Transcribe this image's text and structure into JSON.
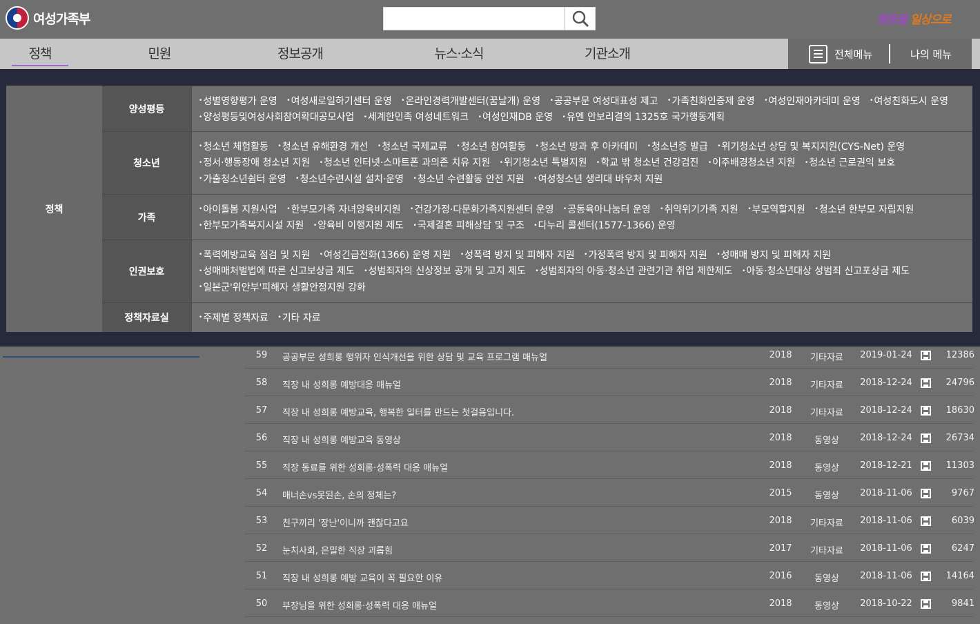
{
  "header": {
    "logo_text": "여성가족부",
    "search_placeholder": "",
    "slogan_a": "평등을",
    "slogan_b": "일상으로"
  },
  "gnb": [
    {
      "label": "정책",
      "active": true
    },
    {
      "label": "민원"
    },
    {
      "label": "정보공개"
    },
    {
      "label": "뉴스·소식"
    },
    {
      "label": "기관소개"
    }
  ],
  "gnb_right": {
    "all_menu": "전체메뉴",
    "my_menu": "나의 메뉴"
  },
  "mega": {
    "category": "정책",
    "sections": [
      {
        "title": "양성평등",
        "items": [
          "성별영향평가 운영",
          "여성새로일하기센터 운영",
          "온라인경력개발센터(꿈날개) 운영",
          "공공부문 여성대표성 제고",
          "가족친화인증제 운영",
          "여성인재아카데미 운영",
          "여성친화도시 운영",
          "양성평등및여성사회참여확대공모사업",
          "세계한민족 여성네트워크",
          "여성인재DB 운영",
          "유엔 안보리결의 1325호 국가행동계획"
        ]
      },
      {
        "title": "청소년",
        "items": [
          "청소년 체험활동",
          "청소년 유해환경 개선",
          "청소년 국제교류",
          "청소년 참여활동",
          "청소년 방과 후 아카데미",
          "청소년증 발급",
          "위기청소년 상담 및 복지지원(CYS-Net) 운영",
          "정서·행동장애 청소년 지원",
          "청소년 인터넷·스마트폰 과의존 치유 지원",
          "위기청소년 특별지원",
          "학교 밖 청소년 건강검진",
          "이주배경청소년 지원",
          "청소년 근로권익 보호",
          "가출청소년쉼터 운영",
          "청소년수련시설 설치·운영",
          "청소년 수련활동 안전 지원",
          "여성청소년 생리대 바우처 지원"
        ]
      },
      {
        "title": "가족",
        "items": [
          "아이돌봄 지원사업",
          "한부모가족 자녀양육비지원",
          "건강가정·다문화가족지원센터 운영",
          "공동육아나눔터 운영",
          "취약위기가족 지원",
          "부모역할지원",
          "청소년 한부모 자립지원",
          "한부모가족복지시설 지원",
          "양육비 이행지원 제도",
          "국제결혼 피해상담 및 구조",
          "다누리 콜센터(1577-1366) 운영"
        ]
      },
      {
        "title": "인권보호",
        "items": [
          "폭력예방교육 점검 및 지원",
          "여성긴급전화(1366) 운영 지원",
          "성폭력 방지 및 피해자 지원",
          "가정폭력 방지 및 피해자 지원",
          "성매매 방지 및 피해자 지원",
          "성매매처벌법에 따른 신고보상금 제도",
          "성범죄자의 신상정보 공개 및 고지 제도",
          "성범죄자의 아동·청소년 관련기관 취업 제한제도",
          "아동·청소년대상 성범죄 신고포상금 제도",
          "일본군'위안부'피해자 생활안정지원 강화"
        ]
      },
      {
        "title": "정책자료실",
        "items": [
          "주제별 정책자료",
          "기타 자료"
        ]
      }
    ]
  },
  "list": [
    {
      "no": "59",
      "title": "공공부문 성희롱 행위자 인식개선을 위한 상담 및 교육 프로그램 매뉴얼",
      "year": "2018",
      "type": "기타자료",
      "date": "2019-01-24",
      "views": "12386"
    },
    {
      "no": "58",
      "title": "직장 내 성희롱 예방대응 매뉴얼",
      "year": "2018",
      "type": "기타자료",
      "date": "2018-12-24",
      "views": "24796"
    },
    {
      "no": "57",
      "title": "직장 내 성희롱 예방교육, 행복한 일터를 만드는 첫걸음입니다.",
      "year": "2018",
      "type": "기타자료",
      "date": "2018-12-24",
      "views": "18630"
    },
    {
      "no": "56",
      "title": "직장 내 성희롱 예방교육 동영상",
      "year": "2018",
      "type": "동영상",
      "date": "2018-12-24",
      "views": "26734"
    },
    {
      "no": "55",
      "title": "직장 동료를 위한 성희롱·성폭력 대응 매뉴얼",
      "year": "2018",
      "type": "동영상",
      "date": "2018-12-21",
      "views": "11303"
    },
    {
      "no": "54",
      "title": "매너손vs못된손, 손의 정체는?",
      "year": "2015",
      "type": "동영상",
      "date": "2018-11-06",
      "views": "9767"
    },
    {
      "no": "53",
      "title": "친구끼리 '장난'이니까 괜찮다고요",
      "year": "2018",
      "type": "기타자료",
      "date": "2018-11-06",
      "views": "6039"
    },
    {
      "no": "52",
      "title": "눈치사회, 은밀한 직장 괴롭힘",
      "year": "2017",
      "type": "기타자료",
      "date": "2018-11-06",
      "views": "6247"
    },
    {
      "no": "51",
      "title": "직장 내 성희롱 예방 교육이 꼭 필요한 이유",
      "year": "2016",
      "type": "동영상",
      "date": "2018-11-06",
      "views": "14164"
    },
    {
      "no": "50",
      "title": "부장님을 위한 성희롱·성폭력 대응 매뉴얼",
      "year": "2018",
      "type": "동영상",
      "date": "2018-10-22",
      "views": "9841"
    }
  ]
}
